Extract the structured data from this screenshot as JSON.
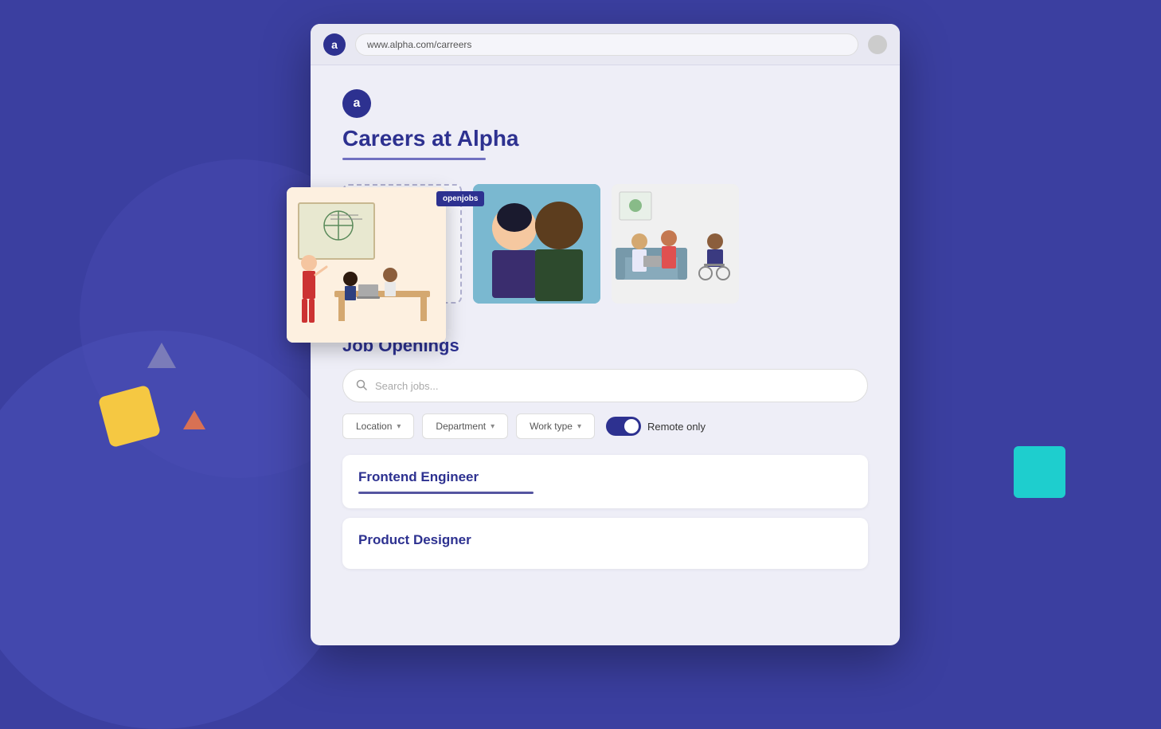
{
  "browser": {
    "url": "www.alpha.com/carreers",
    "logo_letter": "a"
  },
  "page": {
    "logo_letter": "a",
    "title": "Careers at Alpha",
    "openjobs_badge": "openjobs",
    "gallery": {
      "placeholder_icon": "+",
      "alt_team": "Team photo",
      "alt_office": "Office team"
    },
    "job_openings": {
      "section_title": "Job Openings",
      "search_placeholder": "Search jobs...",
      "filters": [
        {
          "label": "Location"
        },
        {
          "label": "Department"
        },
        {
          "label": "Work type"
        }
      ],
      "remote_toggle": {
        "label": "Remote only",
        "active": true
      },
      "jobs": [
        {
          "title": "Frontend Engineer"
        },
        {
          "title": "Product Designer"
        }
      ]
    }
  },
  "decorative": {
    "triangle_gray": "gray triangle",
    "square_yellow": "yellow square",
    "triangle_orange": "orange triangle",
    "teal_rect": "teal rectangle"
  }
}
